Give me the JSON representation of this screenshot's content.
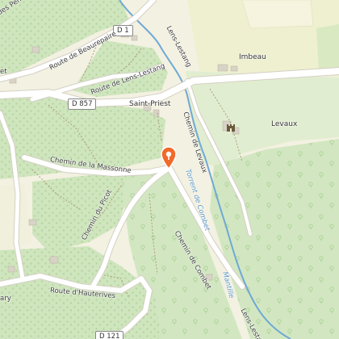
{
  "map": {
    "colors": {
      "open_land": "#f3f1e1",
      "forest": "#cfe5bd",
      "forest_tree": "#b2d39c",
      "farmland": "#e3eec6",
      "road": "#ffffff",
      "road_casing": "#d4d0c4",
      "water": "#6fa8d6",
      "path": "#a89673",
      "marker": "#f06a2a"
    },
    "roads": {
      "d1": "D 1",
      "d857": "D 857",
      "beaurepaire": "Route de Beaurepaire",
      "lens_lestang_route": "Route de Lens-Lestang",
      "lens_lestang_top": "Lens-Lestang",
      "lens_lestang_bottom": "Lens-Lestang",
      "massonne": "Chemin de la Massonne",
      "picot": "Chemin du Picot",
      "hauterives": "Route d'Hauterives",
      "levaux_chemin": "Chemin de Levaux",
      "combet_chemin": "Chemin de Combet",
      "du_pens": "des Pens",
      "bottom_shield": "D 121",
      "left_edge_top": "et",
      "left_edge_bottom": "ary"
    },
    "water": {
      "torrent": "Torrent de Combet",
      "mantille": "Mantille"
    },
    "places": {
      "saint_priest": "Saint-Priest",
      "imbeau": "Imbeau",
      "levaux": "Levaux"
    },
    "icons": {
      "marker": "location-pin-icon",
      "castle": "castle-icon"
    }
  }
}
